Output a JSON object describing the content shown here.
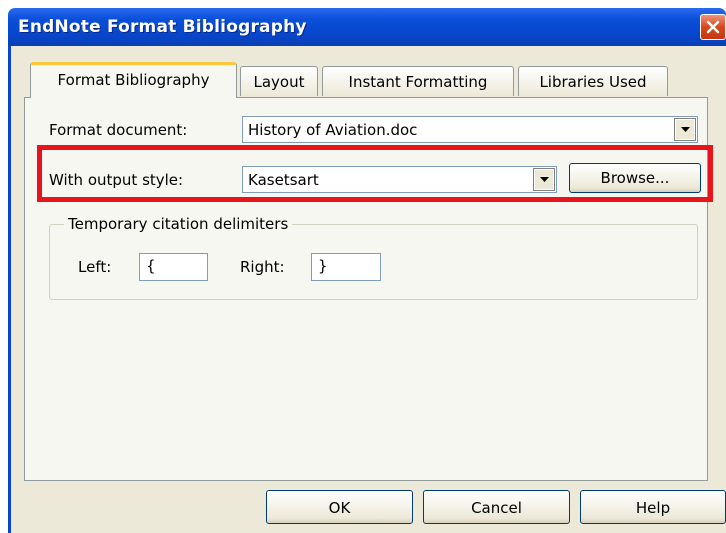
{
  "window": {
    "title": "EndNote Format Bibliography"
  },
  "tabs": [
    "Format Bibliography",
    "Layout",
    "Instant Formatting",
    "Libraries Used"
  ],
  "format_document": {
    "label": "Format document:",
    "value": "History of Aviation.doc"
  },
  "output_style": {
    "label": "With output style:",
    "value": "Kasetsart",
    "browse_label": "Browse..."
  },
  "delimiters": {
    "group_label": "Temporary citation delimiters",
    "left_label": "Left:",
    "left_value": "{",
    "right_label": "Right:",
    "right_value": "}"
  },
  "buttons": {
    "ok": "OK",
    "cancel": "Cancel",
    "help": "Help"
  },
  "colors": {
    "titlebar": "#0a4fd8",
    "highlight": "#e8141b",
    "active_tab_accent": "#ffc83c"
  },
  "icons": {
    "close": "close-icon",
    "dropdown": "chevron-down-icon"
  }
}
